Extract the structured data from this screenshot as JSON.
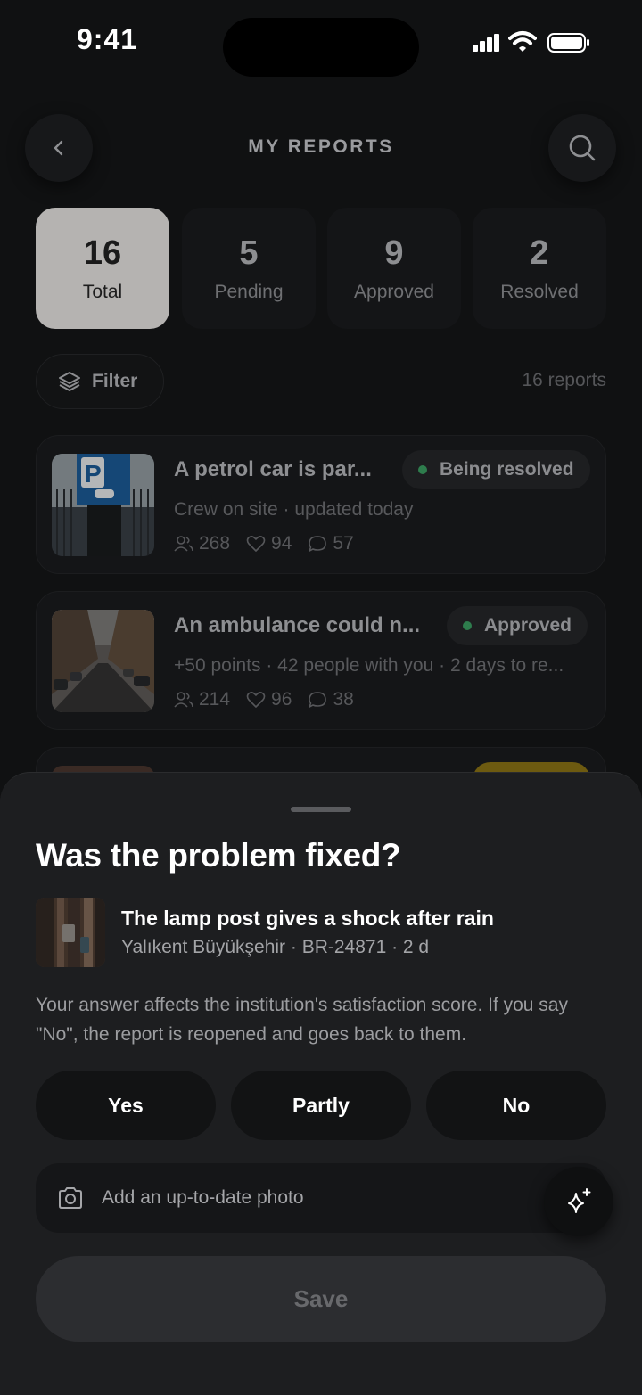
{
  "status_bar": {
    "time": "9:41"
  },
  "header": {
    "title": "MY REPORTS",
    "back_icon": "chevron-left-icon",
    "search_icon": "search-icon"
  },
  "stats": [
    {
      "value": "16",
      "label": "Total",
      "active": true
    },
    {
      "value": "5",
      "label": "Pending",
      "active": false
    },
    {
      "value": "9",
      "label": "Approved",
      "active": false
    },
    {
      "value": "2",
      "label": "Resolved",
      "active": false
    }
  ],
  "toolbar": {
    "filter_label": "Filter",
    "filter_icon": "layers-icon",
    "count_label": "16 reports"
  },
  "reports": [
    {
      "title": "A petrol car is par...",
      "status": "Being resolved",
      "status_color": "#2e7d4d",
      "subtitle": "Crew on site · updated today",
      "followers": "268",
      "likes": "94",
      "comments": "57"
    },
    {
      "title": "An ambulance could n...",
      "status": "Approved",
      "status_color": "#2e7d4d",
      "subtitle": "+50 points · 42 people with you · 2 days to re...",
      "followers": "214",
      "likes": "96",
      "comments": "38"
    }
  ],
  "sheet": {
    "title": "Was the problem fixed?",
    "report_title": "The lamp post gives a shock after rain",
    "report_meta": "Yalıkent Büyükşehir · BR-24871 · 2 d",
    "description": "Your answer affects the institution's satisfaction score. If you say \"No\", the report is reopened and goes back to them.",
    "choices": [
      "Yes",
      "Partly",
      "No"
    ],
    "photo_label": "Add an up-to-date photo",
    "photo_icon": "camera-icon",
    "assist_icon": "sparkle-icon",
    "save_label": "Save"
  }
}
